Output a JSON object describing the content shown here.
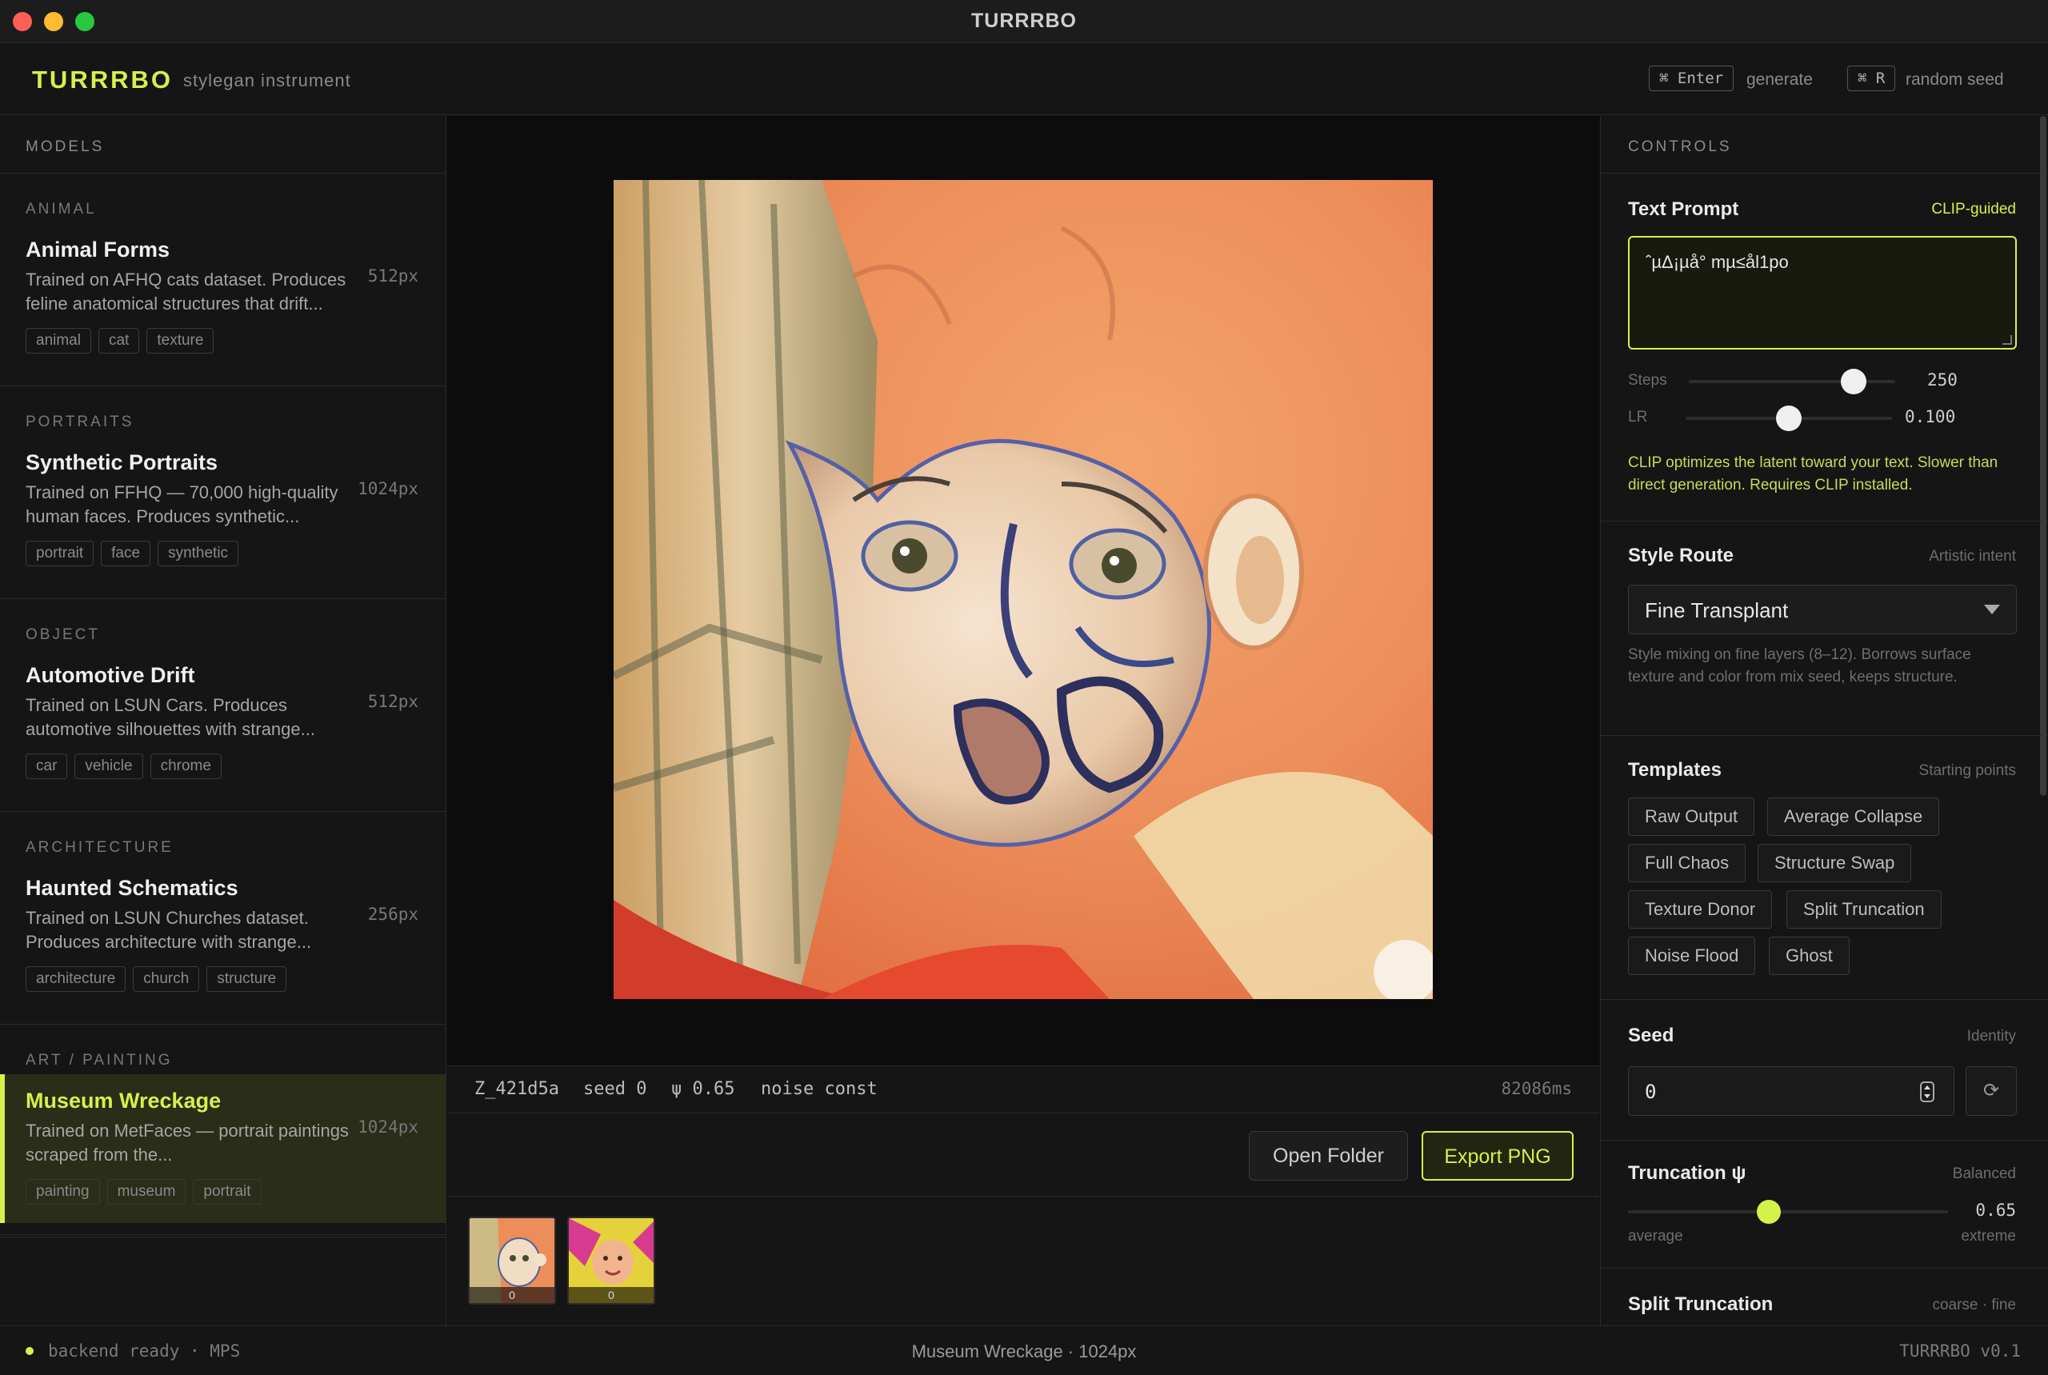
{
  "window": {
    "title": "TURRRBO"
  },
  "header": {
    "brand": "TURRRBO",
    "subtitle": "stylegan instrument",
    "shortcuts": [
      {
        "keys": "⌘ Enter",
        "label": "generate"
      },
      {
        "keys": "⌘ R",
        "label": "random seed"
      }
    ]
  },
  "sidebar": {
    "title": "MODELS",
    "models": [
      {
        "category": "ANIMAL",
        "name": "Animal Forms",
        "desc": "Trained on AFHQ cats dataset. Produces feline anatomical structures that drift...",
        "res": "512px",
        "tags": [
          "animal",
          "cat",
          "texture"
        ]
      },
      {
        "category": "PORTRAITS",
        "name": "Synthetic Portraits",
        "desc": "Trained on FFHQ — 70,000 high-quality human faces. Produces synthetic...",
        "res": "1024px",
        "tags": [
          "portrait",
          "face",
          "synthetic"
        ]
      },
      {
        "category": "OBJECT",
        "name": "Automotive Drift",
        "desc": "Trained on LSUN Cars. Produces automotive silhouettes with strange...",
        "res": "512px",
        "tags": [
          "car",
          "vehicle",
          "chrome"
        ]
      },
      {
        "category": "ARCHITECTURE",
        "name": "Haunted Schematics",
        "desc": "Trained on LSUN Churches dataset. Produces architecture with strange...",
        "res": "256px",
        "tags": [
          "architecture",
          "church",
          "structure"
        ]
      },
      {
        "category": "ART / PAINTING",
        "name": "Museum Wreckage",
        "desc": "Trained on MetFaces — portrait paintings scraped from the...",
        "res": "1024px",
        "tags": [
          "painting",
          "museum",
          "portrait"
        ],
        "active": true
      }
    ]
  },
  "output": {
    "meta": {
      "id": "Z_421d5a",
      "seed": "seed 0",
      "psi": "ψ 0.65",
      "noise": "noise const",
      "time": "82086ms"
    },
    "open_folder": "Open Folder",
    "export": "Export PNG",
    "history": [
      {
        "label": "0"
      },
      {
        "label": "0"
      }
    ]
  },
  "controls": {
    "title": "CONTROLS",
    "text_prompt": {
      "title": "Text Prompt",
      "hint": "CLIP-guided",
      "value": "ˆµΔ¡µå° mµ≤ål1po",
      "steps_label": "Steps",
      "steps_value": "250",
      "steps_fraction": 0.8,
      "lr_label": "LR",
      "lr_value": "0.100",
      "lr_fraction": 0.5,
      "note": "CLIP optimizes the latent toward your text. Slower than direct generation. Requires CLIP installed."
    },
    "style_route": {
      "title": "Style Route",
      "hint": "Artistic intent",
      "selected": "Fine Transplant",
      "note": "Style mixing on fine layers (8–12). Borrows surface texture and color from mix seed, keeps structure."
    },
    "templates": {
      "title": "Templates",
      "hint": "Starting points",
      "items": [
        "Raw Output",
        "Average Collapse",
        "Full Chaos",
        "Structure Swap",
        "Texture Donor",
        "Split Truncation",
        "Noise Flood",
        "Ghost"
      ]
    },
    "seed": {
      "title": "Seed",
      "hint": "Identity",
      "value": "0",
      "reseed": "⟳"
    },
    "truncation": {
      "title": "Truncation ψ",
      "hint": "Balanced",
      "value": "0.65",
      "fraction": 0.44,
      "min_label": "average",
      "max_label": "extreme"
    },
    "split_truncation": {
      "title": "Split Truncation",
      "hint": "coarse · fine"
    }
  },
  "status": {
    "left": "backend ready · MPS",
    "center": "Museum Wreckage · 1024px",
    "right": "TURRRBO v0.1"
  },
  "colors": {
    "accent": "#d4f24a",
    "background": "#111111",
    "panel": "#151515"
  }
}
